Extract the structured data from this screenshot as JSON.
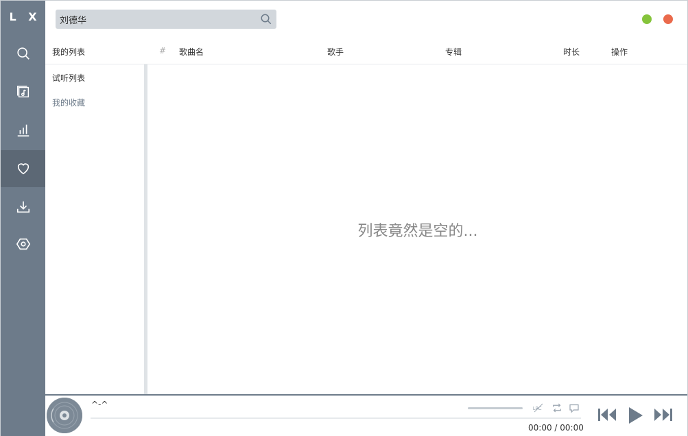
{
  "app": {
    "logo": "L X"
  },
  "sidebar": {
    "items": [
      {
        "name": "search",
        "active": false
      },
      {
        "name": "songlist",
        "active": false
      },
      {
        "name": "leaderboard",
        "active": false
      },
      {
        "name": "my-list",
        "active": true
      },
      {
        "name": "download",
        "active": false
      },
      {
        "name": "settings",
        "active": false
      }
    ]
  },
  "search": {
    "value": "刘德华",
    "placeholder": ""
  },
  "header": {
    "my_list": "我的列表",
    "num": "#",
    "song": "歌曲名",
    "artist": "歌手",
    "album": "专辑",
    "duration": "时长",
    "action": "操作"
  },
  "lists": [
    {
      "label": "试听列表"
    },
    {
      "label": "我的收藏"
    }
  ],
  "main": {
    "empty_text": "列表竟然是空的..."
  },
  "player": {
    "title": "^-^",
    "time": "00:00 / 00:00",
    "progress": 0,
    "lrc_label": "LRC"
  },
  "colors": {
    "sidebar": "#6d7b8a",
    "accent": "#6d7b8a",
    "minimize": "#85c43b",
    "close": "#ea6a4c"
  }
}
